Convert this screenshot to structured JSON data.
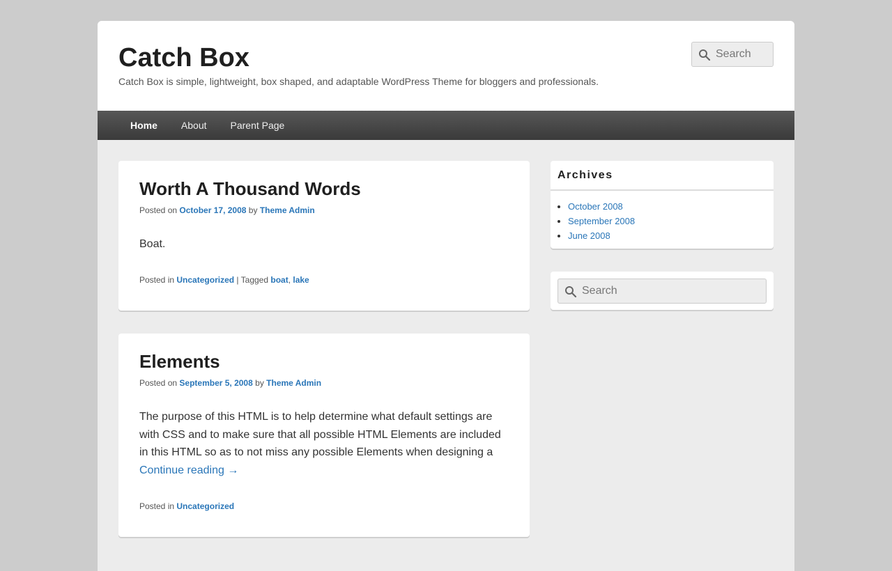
{
  "site": {
    "title": "Catch Box",
    "description": "Catch Box is simple, lightweight, box shaped, and adaptable WordPress Theme for bloggers and professionals."
  },
  "header_search": {
    "placeholder": "Search",
    "icon": "search-icon"
  },
  "nav": {
    "items": [
      {
        "label": "Home",
        "current": true
      },
      {
        "label": "About"
      },
      {
        "label": "Parent Page"
      }
    ]
  },
  "posts": [
    {
      "title": "Worth A Thousand Words",
      "meta": {
        "prefix": "Posted on",
        "date": "October 17, 2008",
        "by": "by",
        "author": "Theme Admin"
      },
      "content": "Boat.",
      "footer": {
        "posted_in": "Posted in",
        "category": "Uncategorized",
        "separator": " | Tagged ",
        "tags": [
          "boat",
          "lake"
        ],
        "tag_sep": ", "
      }
    },
    {
      "title": "Elements",
      "meta": {
        "prefix": "Posted on",
        "date": "September 5, 2008",
        "by": "by",
        "author": "Theme Admin"
      },
      "content": "The purpose of this HTML is to help determine what default settings are with CSS and to make sure that all possible HTML Elements are included in this HTML so as to not miss any possible Elements when designing a",
      "more_link": "Continue reading",
      "more_arrow": "→",
      "footer": {
        "posted_in": "Posted in",
        "category": "Uncategorized"
      }
    }
  ],
  "sidebar": {
    "archives": {
      "title": "Archives",
      "items": [
        "October 2008",
        "September 2008",
        "June 2008"
      ]
    },
    "search": {
      "placeholder": "Search",
      "icon": "search-icon"
    }
  },
  "colors": {
    "link": "#2a76b8",
    "nav_bg": "#474747",
    "page_bg": "#ececec",
    "outer_bg": "#cccccc"
  }
}
